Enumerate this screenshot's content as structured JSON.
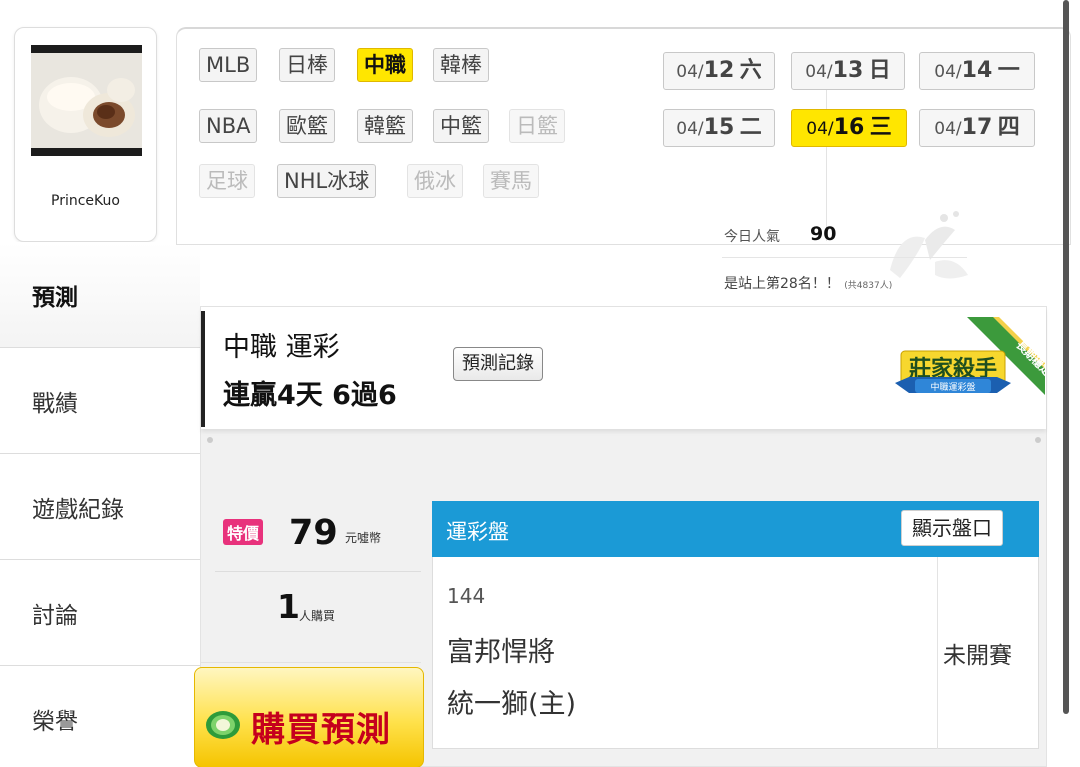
{
  "user": {
    "name": "PrinceKuo",
    "avatar": "steamed-bun-photo"
  },
  "menu": [
    {
      "label": "預測",
      "active": true
    },
    {
      "label": "戰績",
      "active": false
    },
    {
      "label": "遊戲紀錄",
      "active": false
    },
    {
      "label": "討論",
      "active": false
    },
    {
      "label": "榮譽",
      "active": false
    }
  ],
  "leagues": [
    [
      "MLB",
      "日棒",
      "中職",
      "韓棒"
    ],
    [
      "NBA",
      "歐籃",
      "韓籃",
      "中籃",
      "日籃"
    ],
    [
      "足球",
      "NHL冰球",
      "俄冰",
      "賽馬"
    ]
  ],
  "active_league": "中職",
  "disabled_leagues": [
    "日籃",
    "足球",
    "俄冰",
    "賽馬"
  ],
  "dates": [
    {
      "md": "04/",
      "day": "12",
      "wd": "六"
    },
    {
      "md": "04/",
      "day": "13",
      "wd": "日"
    },
    {
      "md": "04/",
      "day": "14",
      "wd": "一"
    },
    {
      "md": "04/",
      "day": "15",
      "wd": "二"
    },
    {
      "md": "04/",
      "day": "16",
      "wd": "三"
    },
    {
      "md": "04/",
      "day": "17",
      "wd": "四"
    }
  ],
  "active_date_index": 4,
  "popularity": {
    "label": "今日人氣",
    "value": "90",
    "rank_text": "是站上第28名！！",
    "rank_count": "(共4837人)"
  },
  "prediction": {
    "title": "中職 運彩",
    "streak": "連贏4天 6過6",
    "record_button": "預測記錄",
    "badge_title": "莊家殺手",
    "badge_sub": "中職運彩盤",
    "badge_ribbon": "長期穩定"
  },
  "pricing": {
    "tag": "特價",
    "price": "79",
    "unit": "元噓幣",
    "buyers": "1",
    "buyers_unit": "人購買",
    "buy_button": "購買預測"
  },
  "odds": {
    "title": "運彩盤",
    "show_button": "顯示盤口",
    "game_no": "144",
    "away_team": "富邦悍將",
    "home_team": "統一獅(主)",
    "status": "未開賽"
  },
  "colors": {
    "accent_yellow": "#ffe600",
    "odds_blue": "#1b9ad6",
    "price_pink": "#e8327c",
    "buy_red": "#c5001d"
  }
}
